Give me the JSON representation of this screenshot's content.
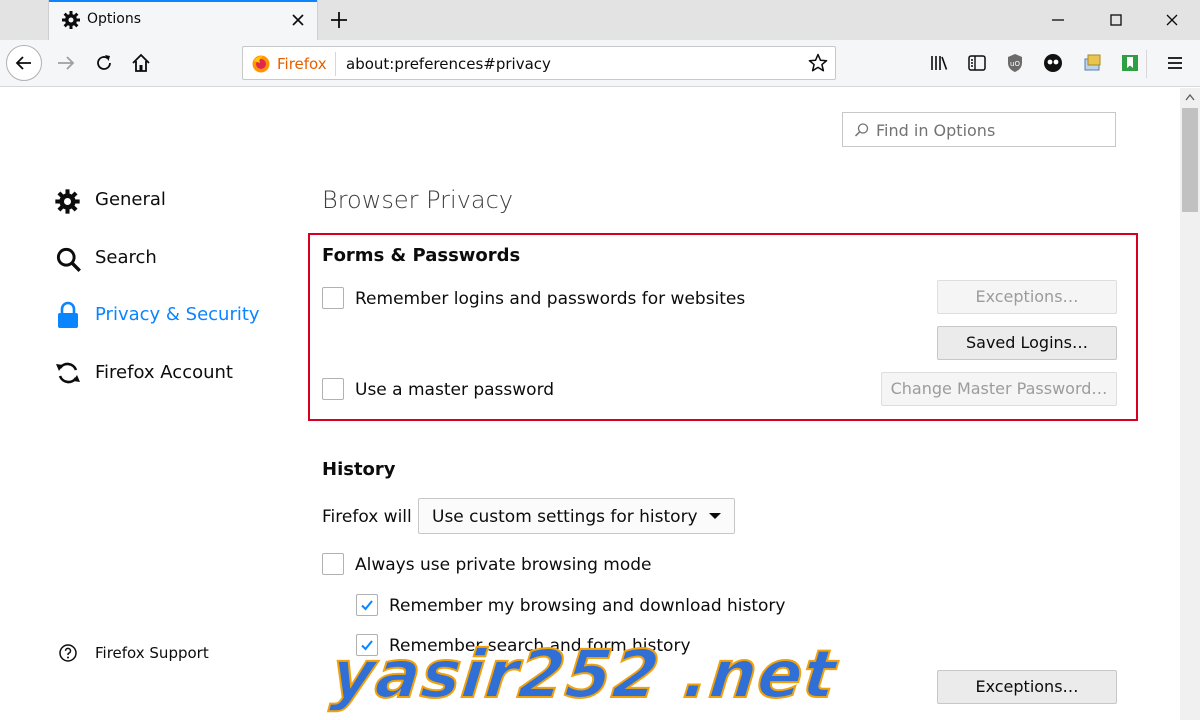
{
  "tab": {
    "title": "Options"
  },
  "urlbar": {
    "identity_label": "Firefox",
    "url": "about:preferences#privacy"
  },
  "search": {
    "placeholder": "Find in Options"
  },
  "sidebar": {
    "items": [
      {
        "label": "General",
        "icon": "gear-icon"
      },
      {
        "label": "Search",
        "icon": "search-icon"
      },
      {
        "label": "Privacy & Security",
        "icon": "lock-icon",
        "active": true
      },
      {
        "label": "Firefox Account",
        "icon": "sync-icon"
      }
    ],
    "support": "Firefox Support"
  },
  "main": {
    "title": "Browser Privacy",
    "forms": {
      "heading": "Forms & Passwords",
      "remember_logins": {
        "label": "Remember logins and passwords for websites",
        "checked": false
      },
      "exceptions_button": "Exceptions…",
      "saved_logins_button": "Saved Logins…",
      "master_password": {
        "label": "Use a master password",
        "checked": false
      },
      "change_master_button": "Change Master Password…"
    },
    "history": {
      "heading": "History",
      "will_label": "Firefox will",
      "mode_value": "Use custom settings for history",
      "private_mode": {
        "label": "Always use private browsing mode",
        "checked": false
      },
      "remember_browsing": {
        "label": "Remember my browsing and download history",
        "checked": true
      },
      "remember_search": {
        "label": "Remember search and form history",
        "checked": true
      },
      "exceptions_button": "Exceptions…"
    }
  },
  "watermark": "yasir252 .net",
  "colors": {
    "accent": "#0a84ff",
    "highlight_border": "#d70022",
    "firefox_orange": "#e66000"
  }
}
